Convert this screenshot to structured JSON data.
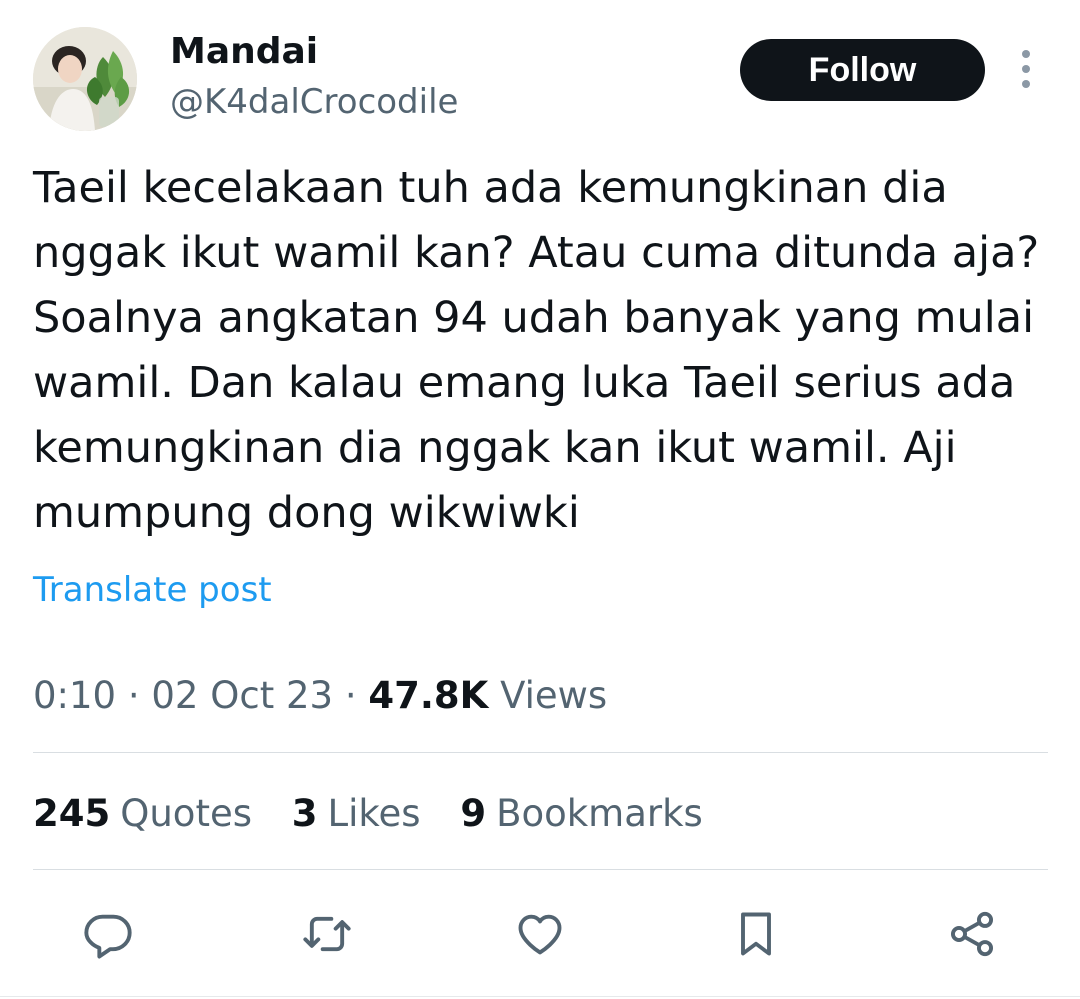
{
  "author": {
    "display_name": "Mandai",
    "handle": "@K4dalCrocodile",
    "avatar_icon": "profile-photo"
  },
  "header": {
    "follow_label": "Follow",
    "more_icon": "more-vertical-icon"
  },
  "tweet": {
    "text": "Taeil kecelakaan tuh ada kemungkinan dia nggak ikut wamil kan? Atau cuma ditunda aja? Soalnya angkatan 94 udah banyak yang mulai wamil. Dan kalau emang luka Taeil serius ada kemungkinan dia nggak kan ikut wamil. Aji mumpung dong wikwiwki",
    "translate_label": "Translate post"
  },
  "meta": {
    "time": "0:10",
    "separator": "·",
    "date": "02 Oct 23",
    "views_count": "47.8K",
    "views_label": "Views"
  },
  "stats": [
    {
      "count": "245",
      "label": "Quotes"
    },
    {
      "count": "3",
      "label": "Likes"
    },
    {
      "count": "9",
      "label": "Bookmarks"
    }
  ],
  "actions": {
    "reply_icon": "reply-icon",
    "retweet_icon": "retweet-icon",
    "like_icon": "heart-icon",
    "bookmark_icon": "bookmark-icon",
    "share_icon": "share-icon"
  },
  "colors": {
    "text": "#0f1419",
    "secondary": "#536471",
    "link": "#1d9bf0",
    "button_bg": "#0f1419",
    "icon": "#536471"
  }
}
